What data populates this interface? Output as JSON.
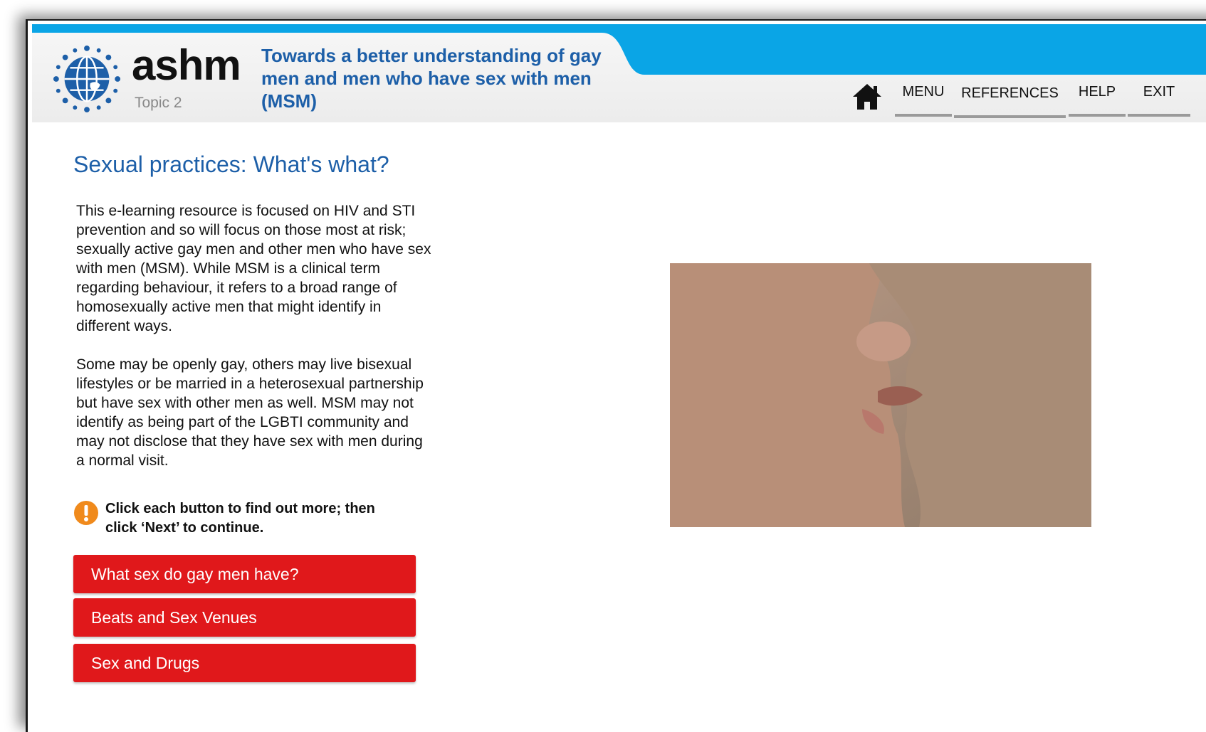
{
  "brand": {
    "logo_text": "ashm",
    "topic": "Topic 2",
    "course_title": "Towards a better understanding of gay men and men who have sex with men (MSM)"
  },
  "nav": {
    "home_icon": "house-icon",
    "items": [
      {
        "label": "MENU"
      },
      {
        "label": "REFERENCES"
      },
      {
        "label": "HELP"
      },
      {
        "label": "EXIT"
      }
    ]
  },
  "main": {
    "title": "Sexual practices: What's what?",
    "paragraphs": [
      "This e-learning resource is focused on HIV and STI prevention and so will focus on those most at risk; sexually active gay men and other men who have sex with men (MSM). While MSM is a clinical term regarding behaviour, it refers to a broad range of homosexually active men that might identify in different ways.",
      "Some may be openly gay, others may live bisexual lifestyles or be married in a heterosexual partnership but have sex with other men as well. MSM may not identify as being part of the LGBTI community and may not disclose that they have sex with men during a normal visit."
    ],
    "instruction_icon": "exclamation-icon",
    "instruction": "Click each button to find out more; then click ‘Next’ to continue.",
    "buttons": [
      {
        "label": "What sex do gay men have?"
      },
      {
        "label": "Beats and Sex Venues"
      },
      {
        "label": "Sex and Drugs"
      }
    ]
  },
  "colors": {
    "header_blue": "#0aa5e6",
    "title_blue": "#1d5fa8",
    "button_red": "#e0181b",
    "alert_orange": "#f08a1c"
  }
}
